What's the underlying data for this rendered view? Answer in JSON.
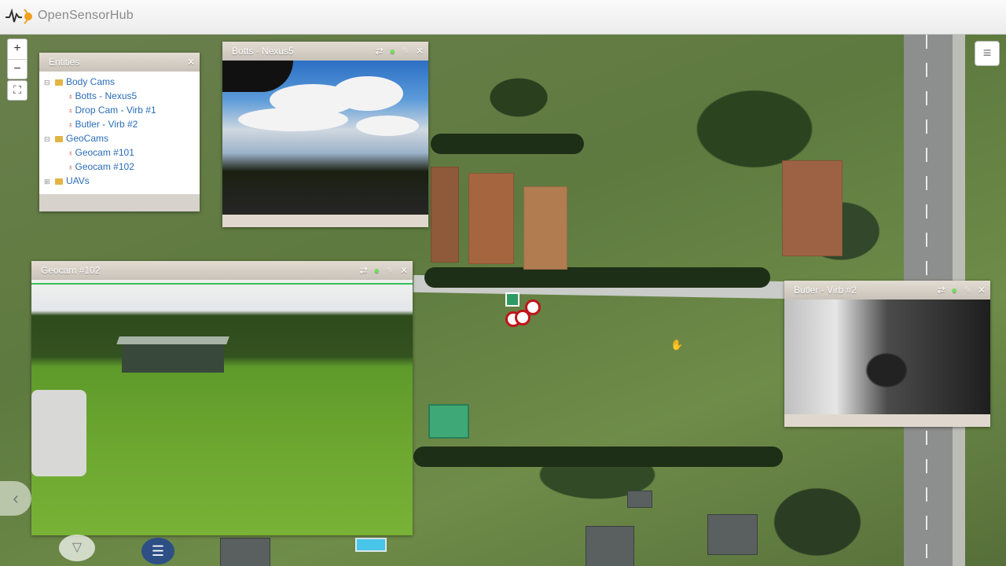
{
  "app": {
    "name": "OpenSensorHub"
  },
  "map_controls": {
    "zoom_in": "+",
    "zoom_out": "−",
    "fullscreen": "⛶",
    "layers": "≡"
  },
  "entities": {
    "title": "Entities",
    "groups": [
      {
        "label": "Body Cams",
        "children": [
          "Botts - Nexus5",
          "Drop Cam - Virb #1",
          "Butler - Virb #2"
        ]
      },
      {
        "label": "GeoCams",
        "children": [
          "Geocam #101",
          "Geocam #102"
        ]
      },
      {
        "label": "UAVs",
        "children": []
      }
    ]
  },
  "panels": {
    "botts": {
      "title": "Botts - Nexus5"
    },
    "geocam": {
      "title": "Geocam #102"
    },
    "butler": {
      "title": "Butler - Virb #2"
    }
  },
  "icons": {
    "swap": "⇄",
    "green": "●",
    "fade": "✎",
    "close": "✕",
    "collapse": "⊟",
    "expand": "⊞",
    "sensor": "♁",
    "menu": "☰",
    "down": "▽",
    "left": "‹",
    "cursor": "✋"
  },
  "colors": {
    "accent": "#2a6db8",
    "marker": "#c0141b",
    "geo_marker": "#2e9a63"
  }
}
